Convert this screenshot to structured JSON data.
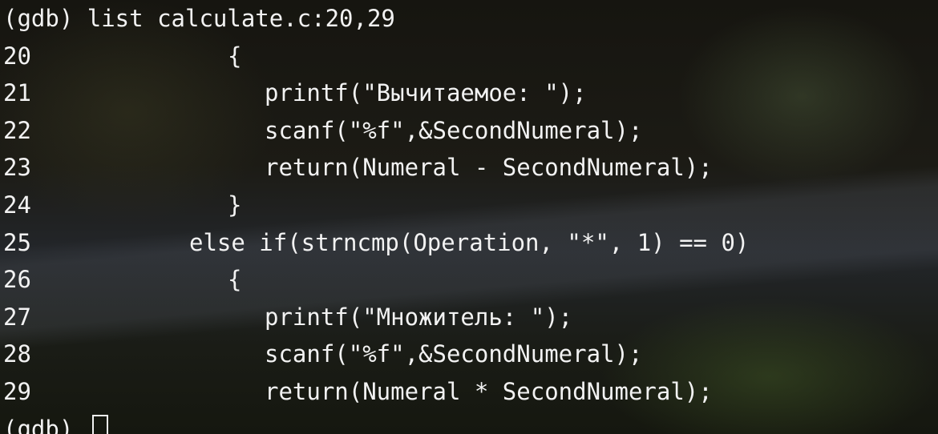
{
  "terminal": {
    "prompt": "(gdb) ",
    "command": "list calculate.c:20,29",
    "source_lines": [
      {
        "number": "20",
        "code": "{"
      },
      {
        "number": "21",
        "code": "printf(\"Вычитаемое: \");"
      },
      {
        "number": "22",
        "code": "scanf(\"%f\",&SecondNumeral);"
      },
      {
        "number": "23",
        "code": "return(Numeral - SecondNumeral);"
      },
      {
        "number": "24",
        "code": "}"
      },
      {
        "number": "25",
        "code": "else if(strncmp(Operation, \"*\", 1) == 0)"
      },
      {
        "number": "26",
        "code": "{"
      },
      {
        "number": "27",
        "code": "printf(\"Множитель: \");"
      },
      {
        "number": "28",
        "code": "scanf(\"%f\",&SecondNumeral);"
      },
      {
        "number": "29",
        "code": "return(Numeral * SecondNumeral);"
      }
    ],
    "final_prompt": "(gdb) "
  }
}
